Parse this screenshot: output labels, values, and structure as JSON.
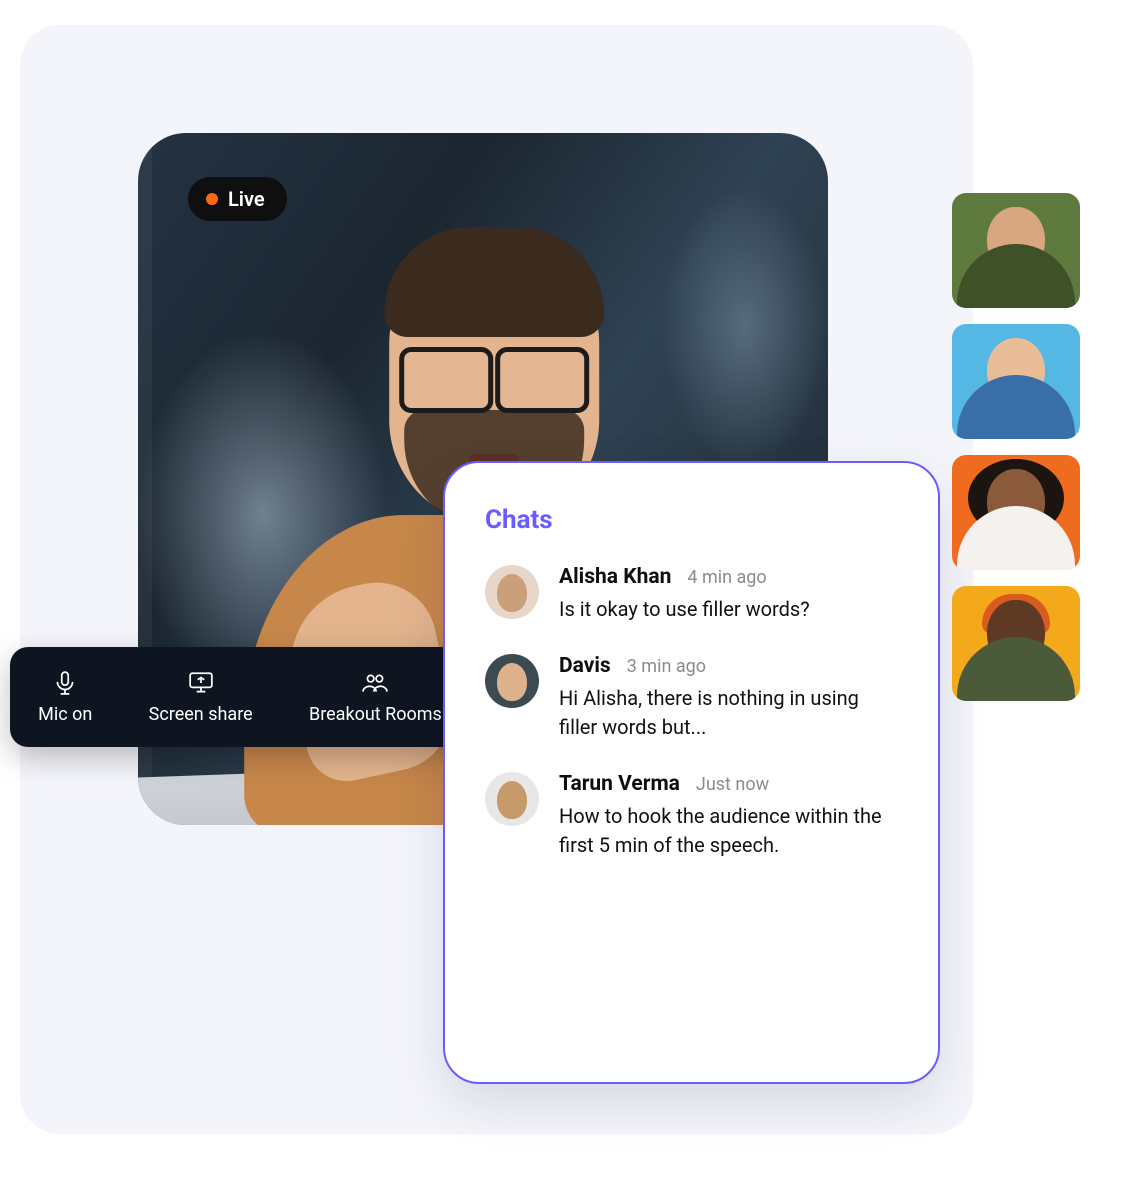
{
  "colors": {
    "accent": "#6a5cff",
    "live_dot": "#ff6a13",
    "toolbar_bg": "#0e1520",
    "canvas_bg": "#f4f5fb"
  },
  "live_badge": {
    "label": "Live"
  },
  "toolbar": {
    "mic": {
      "label": "Mic on",
      "icon": "microphone-icon"
    },
    "share": {
      "label": "Screen share",
      "icon": "screen-share-icon"
    },
    "rooms": {
      "label": "Breakout Rooms",
      "icon": "breakout-rooms-icon"
    }
  },
  "chat": {
    "title": "Chats",
    "messages": [
      {
        "name": "Alisha Khan",
        "time": "4 min ago",
        "text": "Is it okay to use filler words?"
      },
      {
        "name": "Davis",
        "time": "3 min ago",
        "text": "Hi Alisha, there is nothing in using filler words but..."
      },
      {
        "name": "Tarun Verma",
        "time": "Just now",
        "text": "How to hook the audience within the first 5 min of the speech."
      }
    ]
  },
  "participants": [
    {
      "name": "participant-1",
      "bg": "#5f7a3f"
    },
    {
      "name": "participant-2",
      "bg": "#55b7e4"
    },
    {
      "name": "participant-3",
      "bg": "#ef6b1f"
    },
    {
      "name": "participant-4",
      "bg": "#f4a81c"
    }
  ]
}
